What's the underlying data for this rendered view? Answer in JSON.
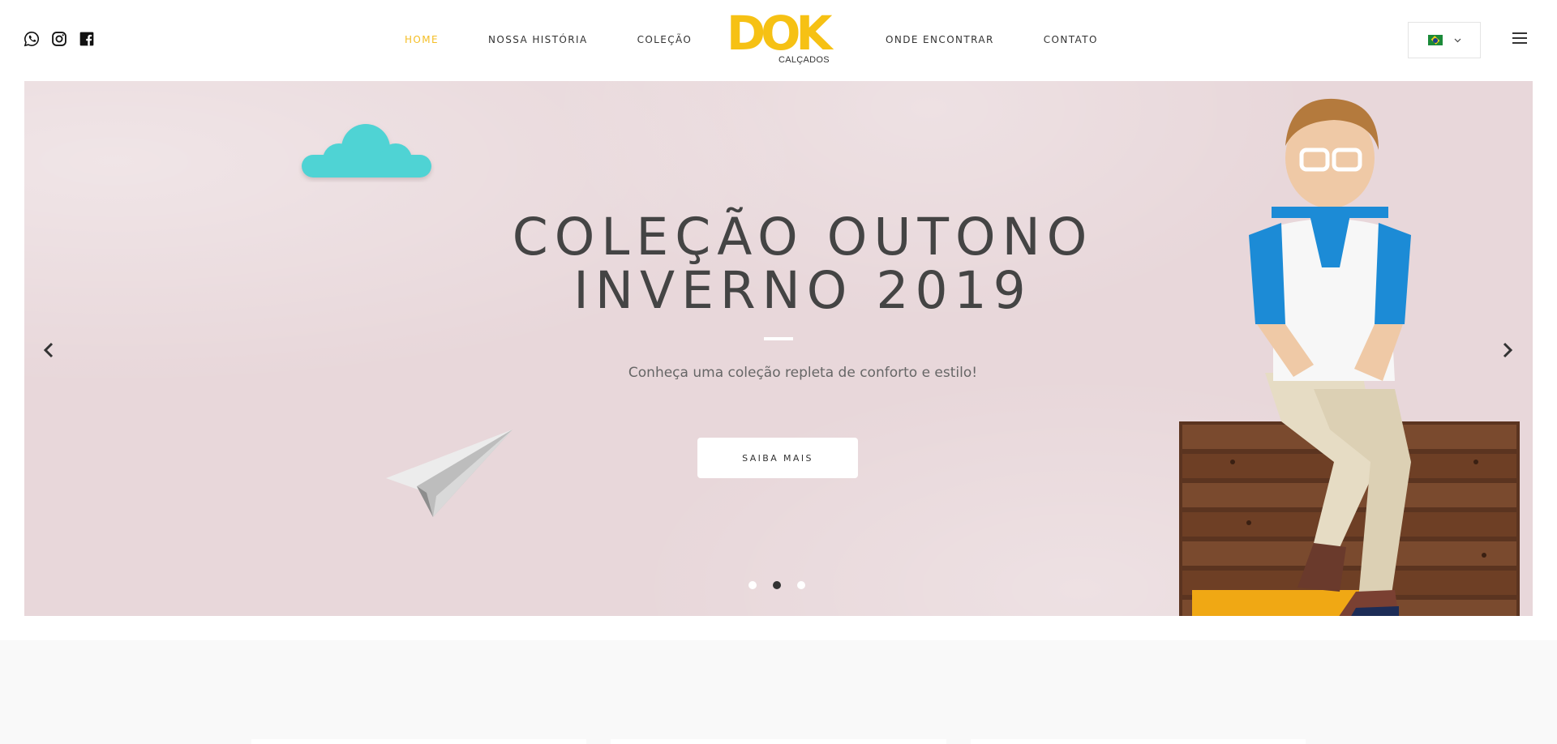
{
  "header": {
    "social": [
      "whatsapp-icon",
      "instagram-icon",
      "facebook-icon"
    ],
    "nav_left": [
      {
        "label": "HOME",
        "active": true
      },
      {
        "label": "NOSSA HISTÓRIA",
        "active": false
      },
      {
        "label": "COLEÇÃO",
        "active": false
      }
    ],
    "nav_right": [
      {
        "label": "ONDE ENCONTRAR",
        "active": false
      },
      {
        "label": "CONTATO",
        "active": false
      }
    ],
    "logo": {
      "word": "DOK",
      "sub": "CALÇADOS"
    },
    "language": {
      "flag": "brazil-flag-icon",
      "chevron": "chevron-down-icon"
    },
    "menu_icon": "hamburger-menu-icon"
  },
  "hero": {
    "title_line1": "COLEÇÃO OUTONO",
    "title_line2": "INVERNO 2019",
    "subtitle": "Conheça uma coleção repleta de conforto e estilo!",
    "button_label": "SAIBA MAIS",
    "slides_total": 3,
    "active_slide": 2
  },
  "colors": {
    "accent": "#f4be25",
    "hero_bg": "#e8d7da",
    "cloud": "#4fd3d4",
    "text_dark": "#444444"
  }
}
